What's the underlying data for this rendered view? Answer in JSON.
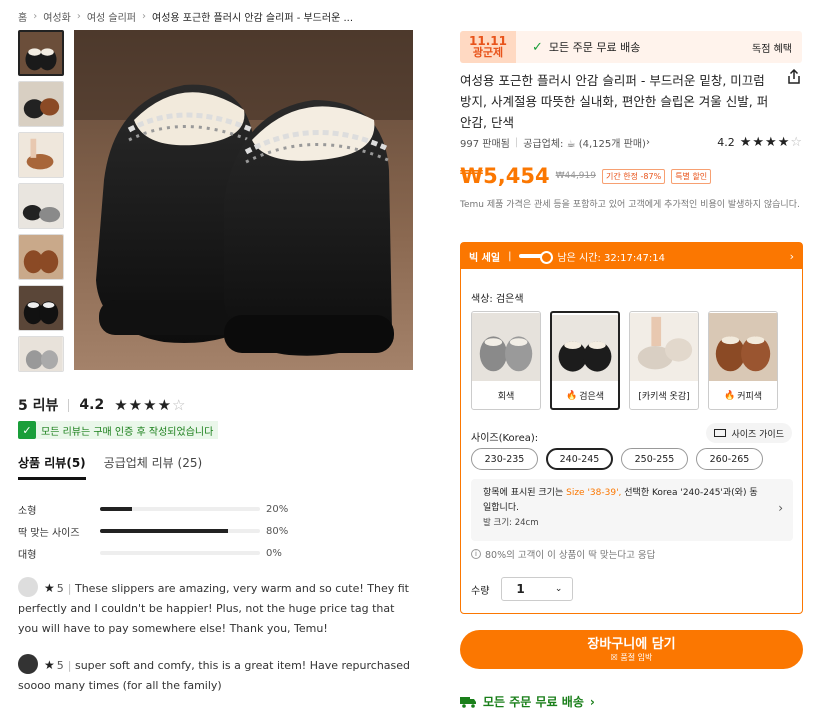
{
  "breadcrumb": {
    "items": [
      "홈",
      "여성화",
      "여성 슬리퍼"
    ],
    "current": "여성용 포근한 플러시 안감 슬리퍼 - 부드러운 ..."
  },
  "gallery": {
    "thumbnail_count": 7,
    "selected_index": 0
  },
  "reviews_summary": {
    "count_label": "5 리뷰",
    "score": "4.2",
    "stars_filled": 4.2,
    "verified_text": "모든 리뷰는 구매 인증 후 작성되었습니다",
    "tabs": [
      {
        "label": "상품 리뷰(5)",
        "active": true
      },
      {
        "label": "공급업체 리뷰 (25)",
        "active": false
      }
    ],
    "fit": [
      {
        "label": "소형",
        "pct_text": "20%",
        "pct": 20
      },
      {
        "label": "딱 맞는 사이즈",
        "pct_text": "80%",
        "pct": 80
      },
      {
        "label": "대형",
        "pct_text": "0%",
        "pct": 0
      }
    ],
    "reviews": [
      {
        "rating": "5",
        "text": "These slippers are amazing, very warm and so cute! They fit perfectly and I couldn't be happier! Plus, not the huge price tag that you will have to pay somewhere else! Thank you, Temu!"
      },
      {
        "rating": "5",
        "text": "super soft and comfy, this is a great item! Have repurchased soooo many times (for all the family)"
      }
    ]
  },
  "promo": {
    "logo_top": "11.11",
    "logo_bottom": "광군제",
    "free_shipping": "모든 주문 무료 배송",
    "exclusive": "독점 혜택"
  },
  "product": {
    "title": "여성용 포근한 플러시 안감 슬리퍼 - 부드러운 밑창, 미끄럼 방지, 사계절용 따뜻한 실내화, 편안한 슬립온 겨울 신발, 퍼 안감, 단색",
    "sold": "997 판매됨",
    "supplier": "공급업체: ☕ (4,125개 판매)",
    "rating": "4.2",
    "price": "₩5,454",
    "original_price": "₩44,919",
    "badge_discount": "기간 한정 -87%",
    "badge_special": "특별 할인",
    "tax_note": "Temu 제품 가격은 관세 등을 포함하고 있어 고객에게 추가적인 비용이 발생하지 않습니다."
  },
  "sale": {
    "label": "빅 세일",
    "timer": "남은 시간: 32:17:47:14",
    "color_label": "색상: 검은색",
    "colors": [
      {
        "name": "회색",
        "hot": false,
        "active": false,
        "color": "#8a8a8a"
      },
      {
        "name": "검은색",
        "hot": true,
        "active": true,
        "color": "#1c1c1c"
      },
      {
        "name": "[카키색 옷감]",
        "hot": false,
        "active": false,
        "color": "#d9cfc3"
      },
      {
        "name": "커피색",
        "hot": true,
        "active": false,
        "color": "#8b4a25"
      }
    ],
    "size_label": "사이즈(Korea):",
    "size_guide": "사이즈 가이드",
    "sizes": [
      {
        "label": "230-235",
        "active": false
      },
      {
        "label": "240-245",
        "active": true
      },
      {
        "label": "250-255",
        "active": false
      },
      {
        "label": "260-265",
        "active": false
      }
    ],
    "size_info_pre": "항목에 표시된 크기는 ",
    "size_info_hl": "Size '38-39',",
    "size_info_post": " 선택한 Korea '240-245'과(와) 동일합니다.",
    "foot_size": "발 크기: 24cm",
    "fit_note": "80%의 고객이 이 상품이 딱 맞는다고 응답",
    "qty_label": "수량",
    "qty_value": "1"
  },
  "cart": {
    "label": "장바구니에 담기",
    "sub": "☒ 품절 임박"
  },
  "free_ship_bottom": "모든 주문 무료 배송",
  "colors": {
    "accent": "#fb7701",
    "green": "#1a7f1a"
  }
}
